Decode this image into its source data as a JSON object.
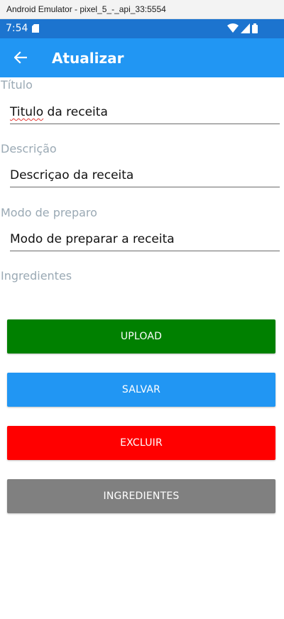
{
  "emulator": {
    "title": "Android Emulator - pixel_5_-_api_33:5554"
  },
  "status_bar": {
    "time": "7:54",
    "icons": [
      "sd-card-icon",
      "wifi-icon",
      "signal-icon",
      "battery-icon"
    ]
  },
  "toolbar": {
    "title": "Atualizar",
    "back_icon": "arrow-left-icon"
  },
  "form": {
    "titulo": {
      "label": "Título",
      "value_misspelled": "Titulo",
      "value_rest": " da receita"
    },
    "descricao": {
      "label": "Descrição",
      "value": "Descriçao da receita"
    },
    "modo": {
      "label": "Modo de preparo",
      "value": "Modo de preparar a receita"
    },
    "ingredientes": {
      "label": "Ingredientes"
    }
  },
  "buttons": {
    "upload": {
      "label": "UPLOAD",
      "color": "#008000"
    },
    "salvar": {
      "label": "SALVAR",
      "color": "#2196f3"
    },
    "excluir": {
      "label": "EXCLUIR",
      "color": "#ff0000"
    },
    "ingredientes": {
      "label": "INGREDIENTES",
      "color": "#808080"
    }
  },
  "colors": {
    "status_bar": "#1c74cf",
    "toolbar": "#2196f3",
    "label": "#9aa9b4"
  }
}
